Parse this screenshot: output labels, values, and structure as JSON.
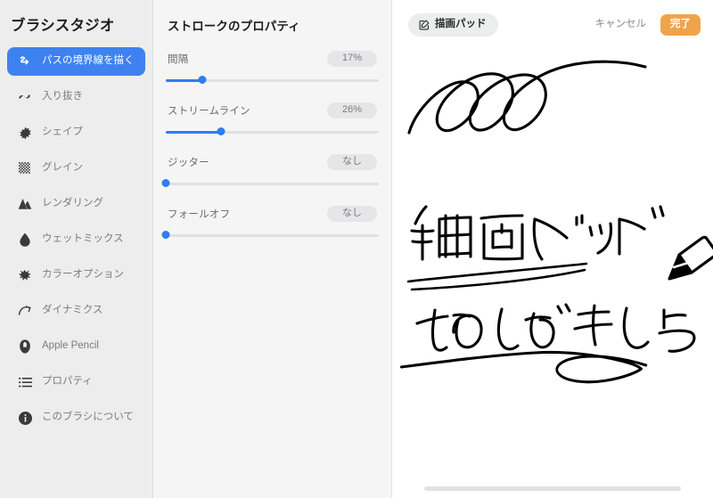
{
  "sidebar": {
    "title": "ブラシスタジオ",
    "items": [
      {
        "label": "パスの境界線を描く",
        "icon": "stroke-path-icon",
        "selected": true
      },
      {
        "label": "入り抜き",
        "icon": "taper-wave-icon",
        "selected": false
      },
      {
        "label": "シェイプ",
        "icon": "shape-star-icon",
        "selected": false
      },
      {
        "label": "グレイン",
        "icon": "grain-dots-icon",
        "selected": false
      },
      {
        "label": "レンダリング",
        "icon": "rendering-mountain-icon",
        "selected": false
      },
      {
        "label": "ウェットミックス",
        "icon": "wet-mix-droplet-icon",
        "selected": false
      },
      {
        "label": "カラーオプション",
        "icon": "color-options-splash-icon",
        "selected": false
      },
      {
        "label": "ダイナミクス",
        "icon": "dynamics-arc-icon",
        "selected": false
      },
      {
        "label": "Apple Pencil",
        "icon": "apple-pencil-icon",
        "selected": false
      },
      {
        "label": "プロパティ",
        "icon": "properties-list-icon",
        "selected": false
      },
      {
        "label": "このブラシについて",
        "icon": "about-info-icon",
        "selected": false
      }
    ]
  },
  "properties": {
    "title": "ストロークのプロパティ",
    "sliders": [
      {
        "label": "間隔",
        "value": "17%",
        "percent": 17
      },
      {
        "label": "ストリームライン",
        "value": "26%",
        "percent": 26
      },
      {
        "label": "ジッター",
        "value": "なし",
        "percent": 0
      },
      {
        "label": "フォールオフ",
        "value": "なし",
        "percent": 0
      }
    ]
  },
  "toolbar": {
    "pad_button_label": "描画パッド",
    "pad_button_icon": "edit-pencil-square-icon",
    "cancel_label": "キャンセル",
    "done_label": "完了"
  },
  "canvas": {
    "handwriting_title": "描画パッド",
    "handwriting_subtitle": "ためしがきしよう"
  },
  "colors": {
    "accent_blue": "#3d82f0",
    "slider_blue": "#2f7df0",
    "done_orange": "#efa44c",
    "sidebar_bg": "#ededed",
    "panel_bg": "#f5f5f5",
    "ink": "#000000"
  }
}
